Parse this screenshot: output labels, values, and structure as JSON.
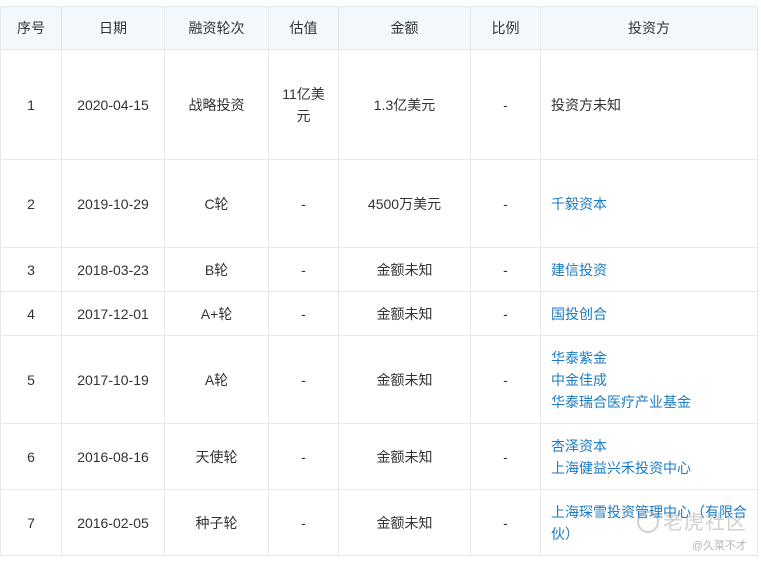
{
  "headers": [
    "序号",
    "日期",
    "融资轮次",
    "估值",
    "金额",
    "比例",
    "投资方"
  ],
  "rows": [
    {
      "no": "1",
      "date": "2020-04-15",
      "round": "战略投资",
      "valuation": "11亿美元",
      "amount": "1.3亿美元",
      "ratio": "-",
      "investors": [
        {
          "name": "投资方未知",
          "link": false
        }
      ]
    },
    {
      "no": "2",
      "date": "2019-10-29",
      "round": "C轮",
      "valuation": "-",
      "amount": "4500万美元",
      "ratio": "-",
      "investors": [
        {
          "name": "千毅资本",
          "link": true
        }
      ]
    },
    {
      "no": "3",
      "date": "2018-03-23",
      "round": "B轮",
      "valuation": "-",
      "amount": "金额未知",
      "ratio": "-",
      "investors": [
        {
          "name": "建信投资",
          "link": true
        }
      ]
    },
    {
      "no": "4",
      "date": "2017-12-01",
      "round": "A+轮",
      "valuation": "-",
      "amount": "金额未知",
      "ratio": "-",
      "investors": [
        {
          "name": "国投创合",
          "link": true
        }
      ]
    },
    {
      "no": "5",
      "date": "2017-10-19",
      "round": "A轮",
      "valuation": "-",
      "amount": "金额未知",
      "ratio": "-",
      "investors": [
        {
          "name": "华泰紫金",
          "link": true
        },
        {
          "name": "中金佳成",
          "link": true
        },
        {
          "name": "华泰瑞合医疗产业基金",
          "link": true
        }
      ]
    },
    {
      "no": "6",
      "date": "2016-08-16",
      "round": "天使轮",
      "valuation": "-",
      "amount": "金额未知",
      "ratio": "-",
      "investors": [
        {
          "name": "杏泽资本",
          "link": true
        },
        {
          "name": "上海健益兴禾投资中心",
          "link": true
        }
      ]
    },
    {
      "no": "7",
      "date": "2016-02-05",
      "round": "种子轮",
      "valuation": "-",
      "amount": "金额未知",
      "ratio": "-",
      "investors": [
        {
          "name": "上海琛雪投资管理中心（有限合伙）",
          "link": true
        }
      ]
    }
  ],
  "watermark": {
    "main": "老虎社区",
    "sub": "@久菜不才"
  },
  "colors": {
    "header_bg": "#f3f8fc",
    "border": "#e4e9ef",
    "link": "#1a7bc4",
    "text": "#333333"
  }
}
